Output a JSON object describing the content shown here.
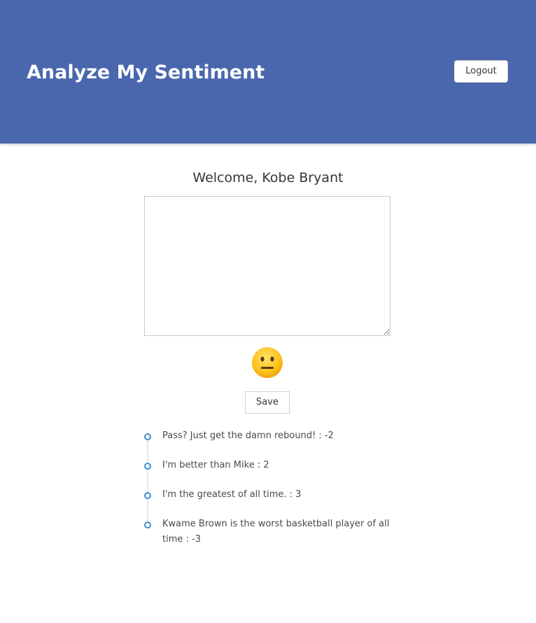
{
  "header": {
    "title": "Analyze My Sentiment",
    "logout_label": "Logout",
    "background_color": "#4a67ad"
  },
  "main": {
    "welcome": "Welcome, Kobe Bryant",
    "textarea": {
      "value": "",
      "placeholder": ""
    },
    "sentiment_emoji": "neutral-face-emoji",
    "save_label": "Save"
  },
  "entries": [
    {
      "text": "Pass? Just get the damn rebound! : -2"
    },
    {
      "text": "I'm better than Mike : 2"
    },
    {
      "text": "I'm the greatest of all time. : 3"
    },
    {
      "text": "Kwame Brown is the worst basketball player of all time : -3"
    }
  ]
}
